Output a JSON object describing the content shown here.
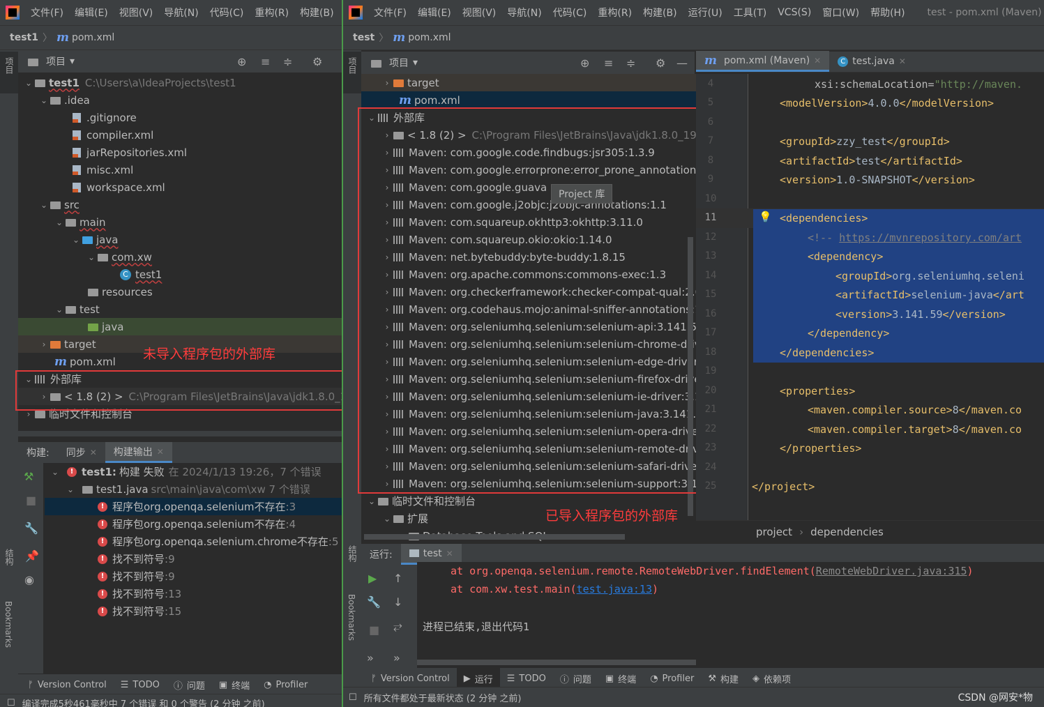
{
  "menu": [
    "文件(F)",
    "编辑(E)",
    "视图(V)",
    "导航(N)",
    "代码(C)",
    "重构(R)",
    "构建(B)",
    "运行(U)",
    "工具(T)",
    "VCS(S)",
    "窗口(W)",
    "帮助(H)"
  ],
  "left": {
    "breadcrumb_project": "test1",
    "breadcrumb_file": "pom.xml",
    "side_label": "项目",
    "tree_header": "项目",
    "tree": {
      "root_name": "test1",
      "root_path": "C:\\Users\\a\\IdeaProjects\\test1",
      "idea": ".idea",
      "gitignore": ".gitignore",
      "compiler": "compiler.xml",
      "jarrepo": "jarRepositories.xml",
      "misc": "misc.xml",
      "workspace": "workspace.xml",
      "src": "src",
      "main": "main",
      "java": "java",
      "comxw": "com.xw",
      "test1": "test1",
      "resources": "resources",
      "test": "test",
      "java2": "java",
      "target": "target",
      "pom": "pom.xml",
      "extlib": "外部库",
      "jdk": "< 1.8 (2) >",
      "jdk_path": "C:\\Program Files\\JetBrains\\Java\\jdk1.8.0_1",
      "scratch": "临时文件和控制台"
    },
    "annotation": "未导入程序包的外部库",
    "build": {
      "label": "构建:",
      "tab_sync": "同步",
      "tab_output": "构建输出",
      "root_title": "test1:",
      "root_status": "构建 失败",
      "root_detail": "在 2024/1/13 19:26，7 个错误",
      "file": "test1.java",
      "file_detail": "src\\main\\java\\com\\xw 7 个错误",
      "errors": [
        {
          "msg": "程序包org.openqa.selenium不存在",
          "line": ":3"
        },
        {
          "msg": "程序包org.openqa.selenium不存在",
          "line": ":4"
        },
        {
          "msg": "程序包org.openqa.selenium.chrome不存在",
          "line": ":5"
        },
        {
          "msg": "找不到符号",
          "line": ":9"
        },
        {
          "msg": "找不到符号",
          "line": ":9"
        },
        {
          "msg": "找不到符号",
          "line": ":13"
        },
        {
          "msg": "找不到符号",
          "line": ":15"
        }
      ]
    },
    "side_structure": "结构",
    "side_bookmarks": "Bookmarks",
    "status": {
      "vc": "Version Control",
      "todo": "TODO",
      "problems": "问题",
      "terminal": "终端",
      "profiler": "Profiler"
    },
    "info": "编译完成5秒461毫秒中 7 个错误 和 0 个警告 (2 分钟 之前)"
  },
  "right": {
    "window_title": "test - pom.xml (Maven)",
    "breadcrumb_project": "test",
    "breadcrumb_file": "pom.xml",
    "side_label": "项目",
    "tree_header": "项目",
    "tree": {
      "target": "target",
      "pom": "pom.xml",
      "extlib": "外部库",
      "jdk": "< 1.8 (2) >",
      "jdk_path": "C:\\Program Files\\JetBrains\\Java\\jdk1.8.0_192",
      "libs": [
        "Maven: com.google.code.findbugs:jsr305:1.3.9",
        "Maven: com.google.errorprone:error_prone_annotations",
        "Maven: com.google.guava",
        "Maven: com.google.j2objc:j2objc-annotations:1.1",
        "Maven: com.squareup.okhttp3:okhttp:3.11.0",
        "Maven: com.squareup.okio:okio:1.14.0",
        "Maven: net.bytebuddy:byte-buddy:1.8.15",
        "Maven: org.apache.commons:commons-exec:1.3",
        "Maven: org.checkerframework:checker-compat-qual:2.0",
        "Maven: org.codehaus.mojo:animal-sniffer-annotations:1",
        "Maven: org.seleniumhq.selenium:selenium-api:3.141.59",
        "Maven: org.seleniumhq.selenium:selenium-chrome-driv",
        "Maven: org.seleniumhq.selenium:selenium-edge-driver",
        "Maven: org.seleniumhq.selenium:selenium-firefox-drive",
        "Maven: org.seleniumhq.selenium:selenium-ie-driver:3.1",
        "Maven: org.seleniumhq.selenium:selenium-java:3.141.5",
        "Maven: org.seleniumhq.selenium:selenium-opera-drive",
        "Maven: org.seleniumhq.selenium:selenium-remote-driv",
        "Maven: org.seleniumhq.selenium:selenium-safari-driver",
        "Maven: org.seleniumhq.selenium:selenium-support:3.1"
      ],
      "scratch": "临时文件和控制台",
      "ext": "扩展",
      "dbtools": "Database Tools and SQL"
    },
    "tooltip": "Project 库",
    "annotation": "已导入程序包的外部库",
    "editor_tabs": [
      {
        "label": "pom.xml (Maven)"
      },
      {
        "label": "test.java"
      }
    ],
    "line_numbers": [
      "4",
      "5",
      "6",
      "7",
      "8",
      "9",
      "10",
      "11",
      "12",
      "13",
      "14",
      "15",
      "16",
      "17",
      "18",
      "19",
      "20",
      "21",
      "22",
      "23",
      "24",
      "25"
    ],
    "code": {
      "l4_attr": "xsi:schemaLocation=",
      "l4_val": "\"http://maven.",
      "l5_open": "<modelVersion>",
      "l5_val": "4.0.0",
      "l5_close": "</modelVersion>",
      "l7_open": "<groupId>",
      "l7_val": "zzy_test",
      "l7_close": "</groupId>",
      "l8_open": "<artifactId>",
      "l8_val": "test",
      "l8_close": "</artifactId>",
      "l9_open": "<version>",
      "l9_val": "1.0-SNAPSHOT",
      "l9_close": "</version>",
      "l11": "<dependencies>",
      "l12_cmt": "<!-- ",
      "l12_link": "https://mvnrepository.com/art",
      "l13": "<dependency>",
      "l14_open": "<groupId>",
      "l14_val": "org.seleniumhq.seleni",
      "l15_open": "<artifactId>",
      "l15_val": "selenium-java",
      "l15_close": "</art",
      "l16_open": "<version>",
      "l16_val": "3.141.59",
      "l16_close": "</version>",
      "l17": "</dependency>",
      "l18": "</dependencies>",
      "l20": "<properties>",
      "l21_open": "<maven.compiler.source>",
      "l21_val": "8",
      "l21_close": "</maven.co",
      "l22_open": "<maven.compiler.target>",
      "l22_val": "8",
      "l22_close": "</maven.co",
      "l23": "</properties>",
      "l25": "</project>"
    },
    "editor_breadcrumb": [
      "project",
      "dependencies"
    ],
    "run": {
      "label": "运行:",
      "tab": "test",
      "line1_prefix": "at org.openqa.selenium.remote.RemoteWebDriver.findElement(",
      "line1_link": "RemoteWebDriver.java:315",
      "line1_suffix": ")",
      "line2_prefix": "at com.xw.test.main(",
      "line2_link": "test.java:13",
      "line2_suffix": ")",
      "exit": "进程已结束,退出代码1"
    },
    "side_structure": "结构",
    "side_bookmarks": "Bookmarks",
    "status": {
      "vc": "Version Control",
      "run": "运行",
      "todo": "TODO",
      "problems": "问题",
      "terminal": "终端",
      "profiler": "Profiler",
      "build": "构建",
      "deps": "依赖项"
    },
    "info": "所有文件都处于最新状态 (2 分钟 之前)",
    "watermark": "CSDN @网安*物"
  },
  "colors": {
    "error": "#d94a4a",
    "annotation": "#ff3c3c",
    "selection": "#214283",
    "link": "#287bde"
  }
}
